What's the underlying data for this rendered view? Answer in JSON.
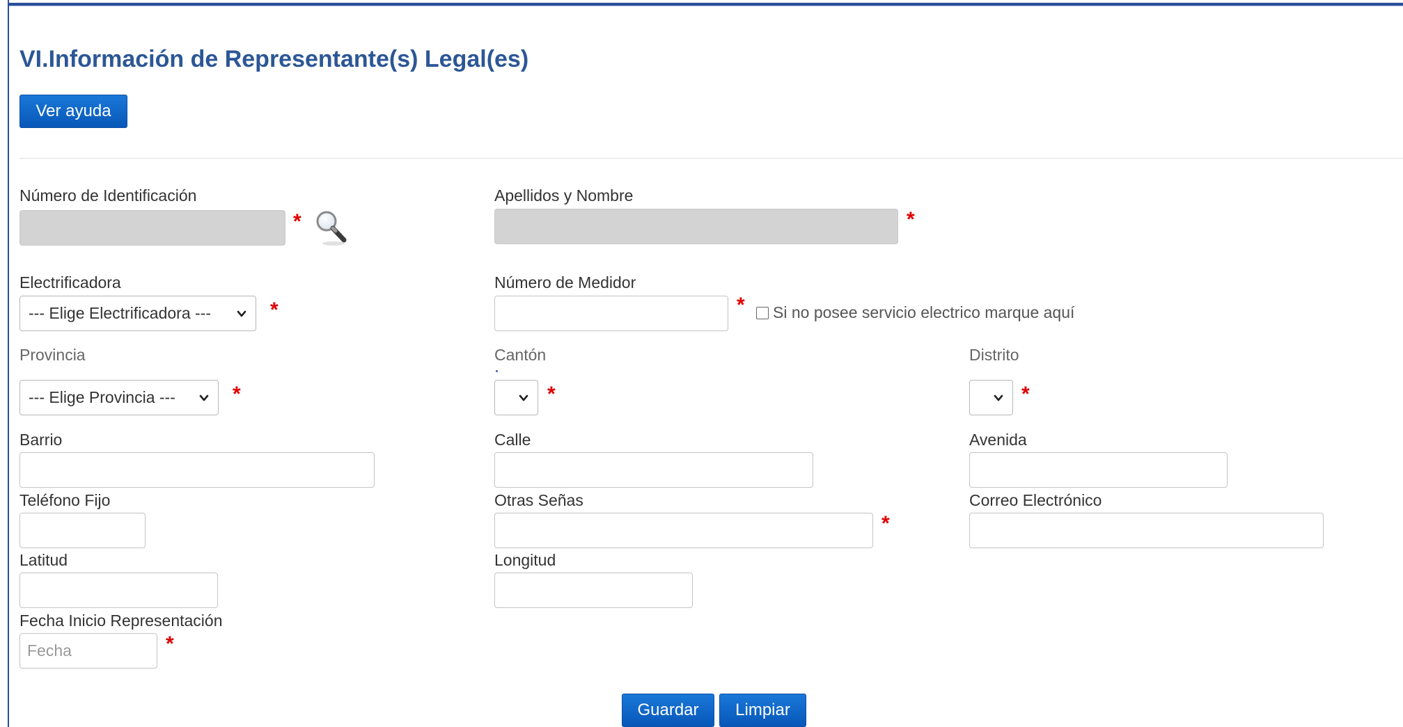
{
  "section": {
    "title": "VI.Información de Representante(s) Legal(es)",
    "help_button": "Ver ayuda"
  },
  "fields": {
    "id_number": {
      "label": "Número de Identificación",
      "value": ""
    },
    "full_name": {
      "label": "Apellidos y Nombre",
      "value": ""
    },
    "electrificadora": {
      "label": "Electrificadora",
      "selected": "--- Elige Electrificadora ---"
    },
    "meter_number": {
      "label": "Número de Medidor",
      "value": ""
    },
    "no_service_checkbox": {
      "label": "Si no posee servicio electrico marque aquí",
      "checked": false
    },
    "provincia": {
      "label": "Provincia",
      "selected": "--- Elige Provincia ---"
    },
    "canton": {
      "label": "Cantón",
      "selected": ""
    },
    "distrito": {
      "label": "Distrito",
      "selected": ""
    },
    "barrio": {
      "label": "Barrio",
      "value": ""
    },
    "calle": {
      "label": "Calle",
      "value": ""
    },
    "avenida": {
      "label": "Avenida",
      "value": ""
    },
    "telefono_fijo": {
      "label": "Teléfono Fijo",
      "value": ""
    },
    "otras_senas": {
      "label": "Otras Señas",
      "value": ""
    },
    "correo": {
      "label": "Correo Electrónico",
      "value": ""
    },
    "latitud": {
      "label": "Latitud",
      "value": ""
    },
    "longitud": {
      "label": "Longitud",
      "value": ""
    },
    "fecha_inicio": {
      "label": "Fecha Inicio Representación",
      "placeholder": "Fecha",
      "value": ""
    }
  },
  "required_marker": "*",
  "actions": {
    "save": "Guardar",
    "clear": "Limpiar"
  },
  "colors": {
    "title": "#2c5796",
    "border": "#2a4f9a",
    "button": "#0a63c9",
    "required": "#e00000",
    "disabled_input": "#d3d3d3"
  },
  "icons": {
    "search": "magnifier-icon",
    "dropdown": "chevron-down-icon"
  }
}
